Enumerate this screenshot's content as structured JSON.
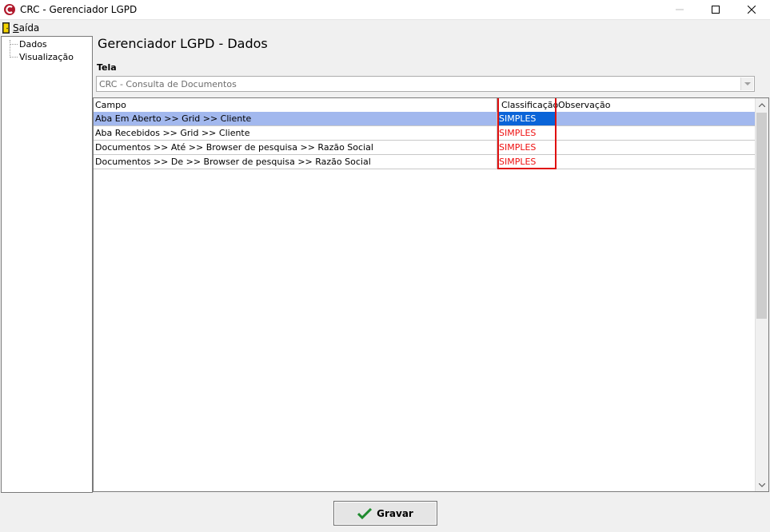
{
  "window": {
    "title": "CRC - Gerenciador LGPD"
  },
  "menu": {
    "saida_label": "Saída"
  },
  "tree": {
    "items": [
      "Dados",
      "Visualização"
    ]
  },
  "page": {
    "title": "Gerenciador LGPD - Dados"
  },
  "tela": {
    "label": "Tela",
    "value": "CRC - Consulta de Documentos"
  },
  "grid": {
    "columns": [
      "Campo",
      "Classificação",
      "Observação"
    ],
    "rows": [
      {
        "campo": "Aba Em Aberto >> Grid >>  Cliente",
        "classificacao": "SIMPLES",
        "observacao": ""
      },
      {
        "campo": "Aba Recebidos >> Grid >> Cliente",
        "classificacao": "SIMPLES",
        "observacao": ""
      },
      {
        "campo": "Documentos >> Até >> Browser de pesquisa >> Razão Social",
        "classificacao": "SIMPLES",
        "observacao": ""
      },
      {
        "campo": "Documentos >> De >> Browser de pesquisa >> Razão Social",
        "classificacao": "SIMPLES",
        "observacao": ""
      }
    ]
  },
  "buttons": {
    "gravar_label": "Gravar"
  },
  "colors": {
    "selection": "#a2b8ee",
    "selected_cell": "#0a64d8",
    "classification_text": "#e11111",
    "highlight_box": "#e01010"
  }
}
